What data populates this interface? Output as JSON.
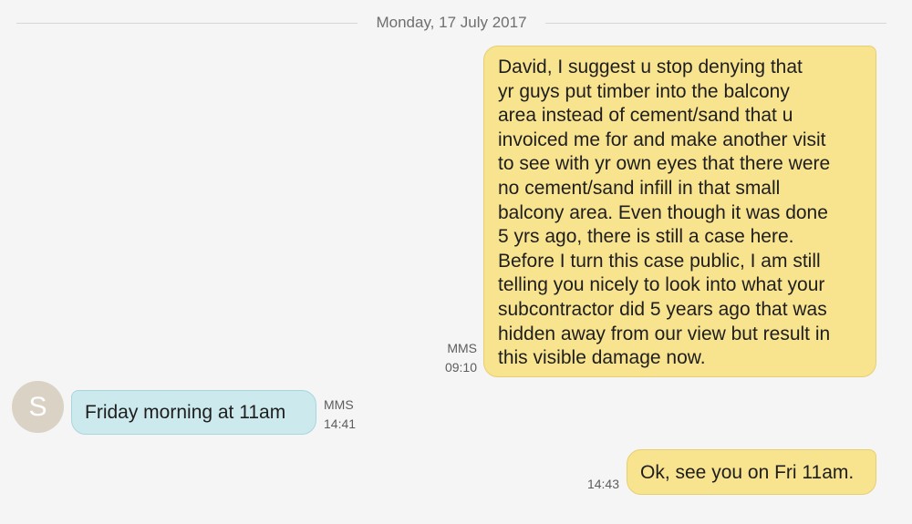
{
  "conversation": {
    "date_divider": "Monday, 17 July 2017",
    "messages": [
      {
        "direction": "sent",
        "lines": [
          "David, I suggest u stop denying that",
          "yr guys put timber into the balcony",
          "area instead of cement/sand that u",
          "invoiced me for and make another visit",
          "to see with yr own eyes that there were",
          "no cement/sand infill in that small",
          "balcony area. Even though it was done",
          "5 yrs ago, there is still a case here.",
          "Before I turn this case public, I am still",
          "telling you nicely to look into what your",
          "subcontractor did 5 years ago that was",
          "hidden away from our view but result in",
          "this visible damage now."
        ],
        "type": "MMS",
        "time": "09:10"
      },
      {
        "direction": "received",
        "avatar_initial": "S",
        "text": "Friday morning at 11am",
        "type": "MMS",
        "time": "14:41"
      },
      {
        "direction": "sent",
        "text": "Ok, see you on Fri 11am.",
        "time": "14:43"
      }
    ]
  },
  "colors": {
    "background": "#f5f5f5",
    "sent_bubble": "#f8e38f",
    "received_bubble": "#cce9ed",
    "avatar": "#d9d2c5"
  }
}
